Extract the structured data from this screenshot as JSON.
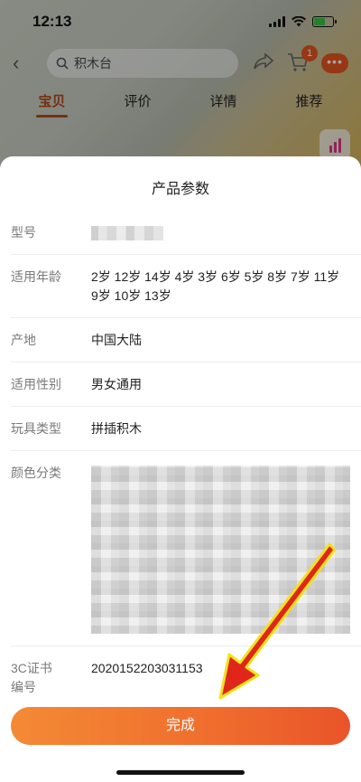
{
  "status_bar": {
    "time": "12:13"
  },
  "nav": {
    "search_text": "积木台",
    "cart_badge": "1",
    "more_label": "•••"
  },
  "tabs": [
    {
      "label": "宝贝",
      "active": true
    },
    {
      "label": "评价",
      "active": false
    },
    {
      "label": "详情",
      "active": false
    },
    {
      "label": "推荐",
      "active": false
    }
  ],
  "sheet": {
    "title": "产品参数",
    "params": [
      {
        "label": "型号",
        "value": ""
      },
      {
        "label": "适用年龄",
        "value": "2岁 12岁 14岁 4岁 3岁 6岁 5岁 8岁 7岁 11岁 9岁 10岁 13岁"
      },
      {
        "label": "产地",
        "value": "中国大陆"
      },
      {
        "label": "适用性别",
        "value": "男女通用"
      },
      {
        "label": "玩具类型",
        "value": "拼插积木"
      },
      {
        "label": "颜色分类",
        "value": ""
      },
      {
        "label": "3C证书编号",
        "value": "2020152203031153"
      }
    ],
    "done_label": "完成"
  },
  "colors": {
    "accent": "#ef6d2d",
    "tab_active": "#b34a1c",
    "arrow": "#e0261a",
    "arrow_outline": "#f2e21a"
  }
}
